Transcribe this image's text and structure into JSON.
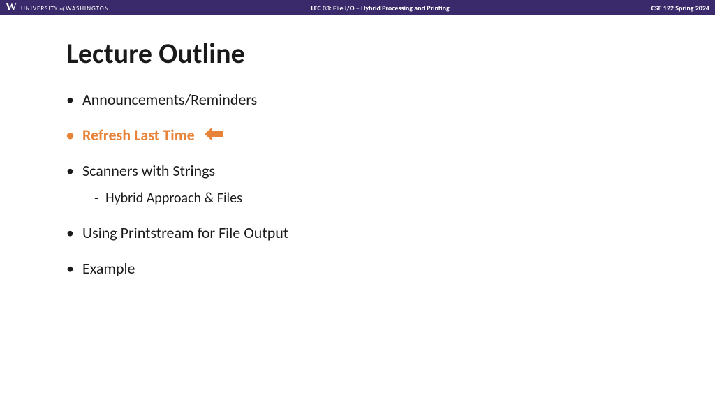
{
  "header": {
    "logo_letter": "W",
    "university_prefix": "UNIVERSITY",
    "university_of": "of",
    "university_name": "WASHINGTON",
    "lecture_title": "LEC 03: File I/O – Hybrid Processing and Printing",
    "course_label": "CSE 122 Spring 2024"
  },
  "slide": {
    "title": "Lecture Outline",
    "items": [
      {
        "text": "Announcements/Reminders",
        "highlighted": false
      },
      {
        "text": "Refresh Last Time",
        "highlighted": true
      },
      {
        "text": "Scanners with Strings",
        "highlighted": false
      },
      {
        "text": "Using Printstream for File Output",
        "highlighted": false
      },
      {
        "text": "Example",
        "highlighted": false
      }
    ],
    "sub_item": "Hybrid Approach & Files"
  },
  "colors": {
    "header_bg": "#3a2a6b",
    "highlight": "#e8833a"
  }
}
